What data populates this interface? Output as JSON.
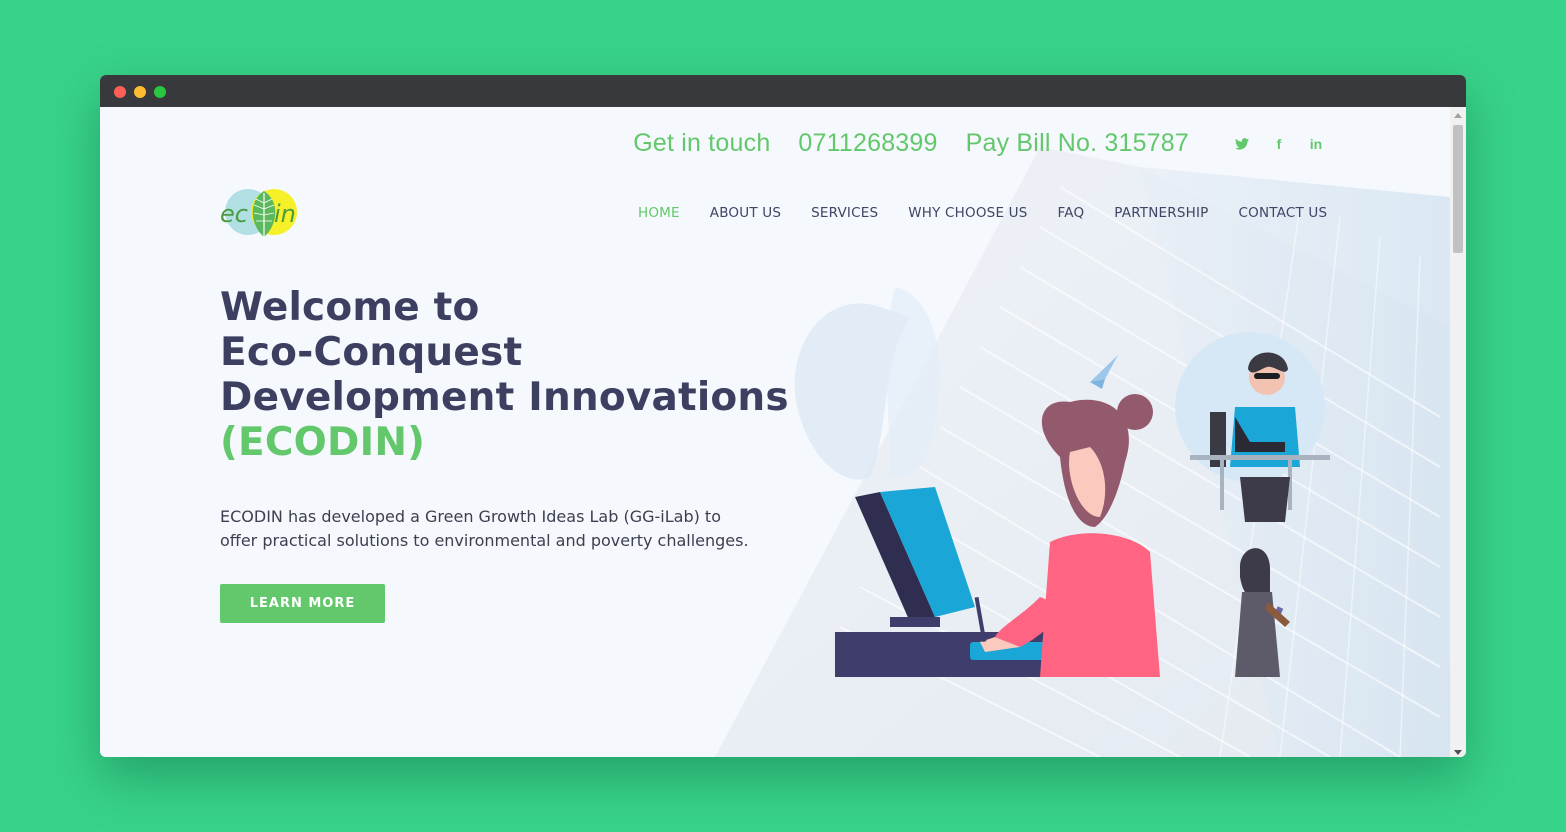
{
  "window": {
    "controls": [
      "close",
      "minimize",
      "maximize"
    ]
  },
  "topbar": {
    "get_in_touch": "Get in touch",
    "phone": "0711268399",
    "paybill": "Pay Bill No. 315787",
    "social": [
      {
        "name": "twitter-icon",
        "glyph": "🐦︎"
      },
      {
        "name": "facebook-icon",
        "glyph": "f"
      },
      {
        "name": "linkedin-icon",
        "glyph": "in"
      }
    ]
  },
  "logo": {
    "text": "ecodin"
  },
  "nav": {
    "items": [
      {
        "label": "HOME",
        "active": true
      },
      {
        "label": "ABOUT US"
      },
      {
        "label": "SERVICES"
      },
      {
        "label": "WHY CHOOSE US"
      },
      {
        "label": "FAQ"
      },
      {
        "label": "PARTNERSHIP"
      },
      {
        "label": "CONTACT US"
      }
    ]
  },
  "hero": {
    "title_lines": [
      "Welcome to",
      "Eco-Conquest",
      "Development Innovations"
    ],
    "title_accent": "(ECODIN)",
    "description": "ECODIN has developed a Green Growth Ideas Lab (GG-iLab) to offer practical solutions to environmental and poverty challenges.",
    "cta_label": "LEARN MORE"
  },
  "colors": {
    "accent": "#63c86b",
    "heading": "#3c3f60",
    "background": "#38d38b"
  }
}
